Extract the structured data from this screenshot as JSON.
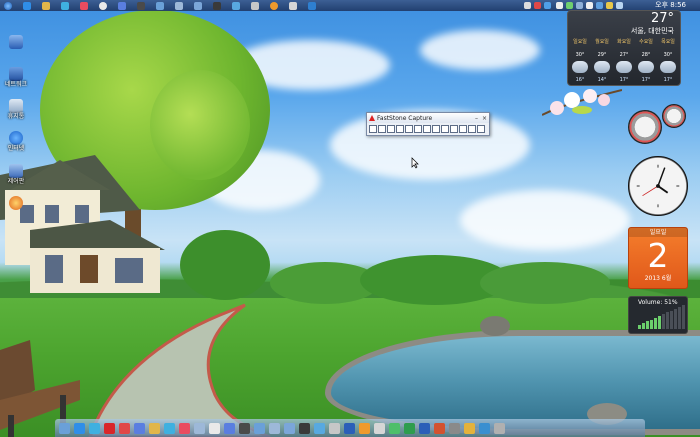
{
  "desktop": {
    "icons": [
      {
        "label": "",
        "color": "#3b6ec9"
      },
      {
        "label": "네트워크",
        "color": "#2d5fb7"
      },
      {
        "label": "휴지통",
        "color": "#9fb7d2"
      },
      {
        "label": "인터넷",
        "color": "#2b78d8"
      },
      {
        "label": "제어판",
        "color": "#5e8bd1"
      },
      {
        "label": "",
        "color": "#e0641e"
      }
    ]
  },
  "topbar": {
    "icons": [
      "start-orb-icon",
      "ie-icon",
      "folder-icon",
      "media-icon",
      "app-icon",
      "clock-app-icon",
      "d-app-icon",
      "video-icon",
      "network-icon",
      "monitor-icon",
      "window-icon",
      "film-icon",
      "image-icon",
      "pin-icon",
      "paint-icon",
      "note-icon",
      "xchat-icon"
    ],
    "clock": "오후 8:56"
  },
  "weather": {
    "temperature": "27°",
    "city": "서울, 대한민국",
    "days": [
      {
        "name": "일요일",
        "high": "30°",
        "low": "16°"
      },
      {
        "name": "월요일",
        "high": "29°",
        "low": "14°"
      },
      {
        "name": "화요일",
        "high": "27°",
        "low": "17°"
      },
      {
        "name": "수요일",
        "high": "28°",
        "low": "17°"
      },
      {
        "name": "목요일",
        "high": "30°",
        "low": "17°"
      }
    ]
  },
  "calendar": {
    "weekday": "일요일",
    "day": "2",
    "year_month": "2013 6월"
  },
  "volume": {
    "label": "Volume: 51%",
    "level": 0.51
  },
  "faststone": {
    "title": "FastStone Capture",
    "tools": [
      "capture-active-window-icon",
      "capture-window-object-icon",
      "capture-rectangle-icon",
      "capture-freehand-icon",
      "capture-full-screen-icon",
      "capture-scrolling-icon",
      "capture-fixed-region-icon",
      "record-video-icon",
      "open-file-icon",
      "output-icon",
      "settings-icon",
      "color-picker-icon",
      "help-icon"
    ]
  },
  "taskbar": {
    "icons": [
      "network-tray-icon",
      "ie-icon",
      "app-blue-icon",
      "opera-icon",
      "red-app-icon",
      "player-icon",
      "folder-icon",
      "media-icon",
      "app-icon",
      "settings-icon",
      "clock-app-icon",
      "d-app-icon",
      "video-icon",
      "network-icon",
      "monitor-icon",
      "window-icon",
      "film-icon",
      "image-icon",
      "pin-icon",
      "word-icon",
      "paint-icon",
      "note-icon",
      "chat-icon",
      "excel-icon",
      "word2-icon",
      "powerpoint-icon",
      "app-icon2",
      "chrome-icon",
      "game-icon",
      "tools-icon"
    ]
  }
}
